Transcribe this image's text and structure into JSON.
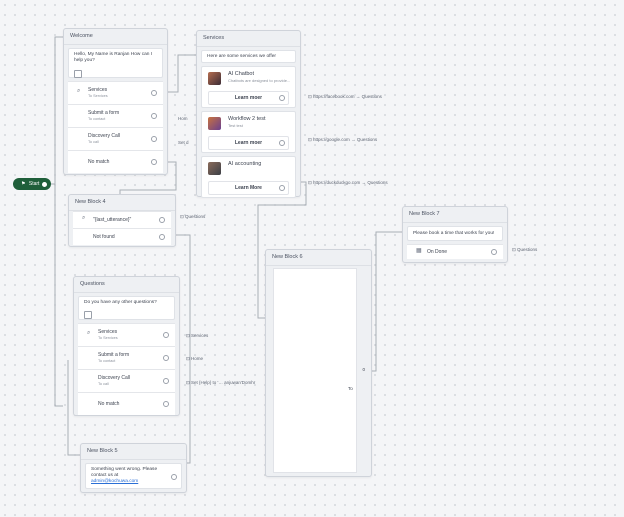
{
  "start": {
    "label": "Start"
  },
  "welcome": {
    "title": "Welcome",
    "message": "Hello, My Name is Ranjan How can I help you?",
    "options": [
      {
        "label": "Services",
        "sub": "To Services"
      },
      {
        "label": "Submit a form",
        "sub": "To contact"
      },
      {
        "label": "Discovery Call",
        "sub": "To call"
      },
      {
        "label": "No match",
        "sub": ""
      }
    ]
  },
  "services": {
    "title": "Services",
    "intro": "Here are some services we offer",
    "items": [
      {
        "title": "AI Chatbot",
        "desc": "Chatbots are designed to provide...",
        "button": "Learn moer",
        "link": "https://facebook.com",
        "target": "Questions"
      },
      {
        "title": "Workflow 2 test",
        "desc": "Test test",
        "button": "Learn moer",
        "link": "https://google.com",
        "target": "Questions"
      },
      {
        "title": "AI accounting",
        "desc": "",
        "button": "Learn More",
        "link": "https://duckduckgo.com",
        "target": "Questions"
      }
    ]
  },
  "block4": {
    "title": "New Block 4",
    "cond": "\"{last_utterance}\"",
    "cond_target": "Questions",
    "notfound": "Not found"
  },
  "questions": {
    "title": "Questions",
    "message": "Do you have any other questions?",
    "options": [
      {
        "label": "Services",
        "sub": "To Services",
        "target": "Services"
      },
      {
        "label": "Submit a form",
        "sub": "To contact",
        "target": "Home"
      },
      {
        "label": "Discovery Call",
        "sub": "To call",
        "target": "Set {Help} to '… anjuwan'Domhr"
      },
      {
        "label": "No match",
        "sub": "",
        "target": ""
      }
    ]
  },
  "block5": {
    "title": "New Block 5",
    "message": "Something went wrong. Please contact us at",
    "email": "admin@kochuwa.com"
  },
  "block6": {
    "title": "New Block 6",
    "zero": "0",
    "to": "To"
  },
  "block7": {
    "title": "New Block 7",
    "message": "Please book a time that works for you!",
    "event": "On Done",
    "target": "Questions"
  },
  "edge_labels": {
    "welcome_submit": "Hom",
    "welcome_call": "Set d"
  },
  "colors": {
    "start": "#1f5f3a",
    "edge": "#a9aeb6"
  }
}
